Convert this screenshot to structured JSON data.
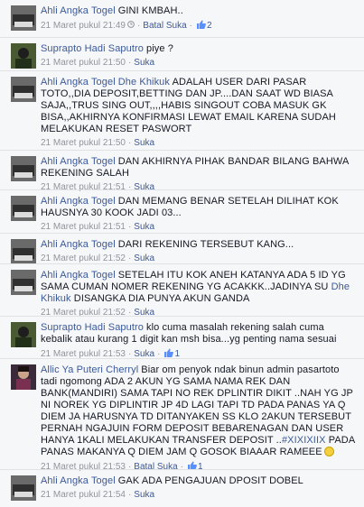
{
  "comments": [
    {
      "author": "Ahli Angka Togel",
      "text": "GINI KMBAH..",
      "timestamp": "21 Maret pukul 21:49",
      "action": "Batal Suka",
      "likes": "2"
    },
    {
      "author": "Suprapto Hadi Saputro",
      "text": "piye ?",
      "timestamp": "21 Maret pukul 21:50",
      "action": "Suka"
    },
    {
      "author": "Ahli Angka Togel",
      "mention": "Dhe Khikuk",
      "text": "ADALAH USER DARI PASAR TOTO,,DIA DEPOSIT,BETTING DAN JP....DAN SAAT WD BIASA SAJA,,TRUS SING OUT,,,,HABIS SINGOUT COBA MASUK GK BISA,,AKHIRNYA KONFIRMASI LEWAT EMAIL KARENA SUDAH MELAKUKAN RESET PASWORT",
      "timestamp": "21 Maret pukul 21:50",
      "action": "Suka"
    },
    {
      "author": "Ahli Angka Togel",
      "text": "DAN AKHIRNYA PIHAK BANDAR BILANG BAHWA REKENING SALAH",
      "timestamp": "21 Maret pukul 21:51",
      "action": "Suka"
    },
    {
      "author": "Ahli Angka Togel",
      "text": "DAN MEMANG BENAR SETELAH DILIHAT KOK HAUSNYA 30 KOOK JADI 03...",
      "timestamp": "21 Maret pukul 21:51",
      "action": "Suka"
    },
    {
      "author": "Ahli Angka Togel",
      "text": "DARI REKENING TERSEBUT KANG...",
      "timestamp": "21 Maret pukul 21:52",
      "action": "Suka"
    },
    {
      "author": "Ahli Angka Togel",
      "text": "SETELAH ITU KOK ANEH KATANYA ADA 5 ID YG SAMA CUMAN NOMER REKENING YG ACAKKK..JADINYA SU",
      "mention_inline": "Dhe Khikuk",
      "text_after": "DISANGKA DIA PUNYA AKUN GANDA",
      "timestamp": "21 Maret pukul 21:52",
      "action": "Suka"
    },
    {
      "author": "Suprapto Hadi Saputro",
      "text": "klo cuma masalah rekening salah cuma kebalik atau kurang 1 digit kan msh bisa...yg penting nama sesuai",
      "timestamp": "21 Maret pukul 21:53",
      "action": "Suka",
      "likes": "1"
    },
    {
      "author": "Allic Ya Puteri Cherryl",
      "text": "Biar om penyok ndak binun admin pasartoto tadi ngomong ADA 2 AKUN YG SAMA NAMA REK DAN BANK(MANDIRI) SAMA TAPI NO REK DPLINTIR DIKIT ..NAH YG JP NI NOREK YG DIPLINTIR JP 4D LAGI TAPI TD PADA PANAS YA Q DIEM JA HARUSNYA TD DITANYAKEN SS KLO 2AKUN TERSEBUT PERNAH NGAJUIN FORM DEPOSIT BEBARENAGAN DAN USER HANYA 1KALI MELAKUKAN TRANSFER DEPOSIT ..",
      "hashtag": "#XIXIXIIX",
      "text_after": "PADA PANAS MAKANYA Q DIEM JAM Q GOSOK BIAAAR RAMEEE",
      "timestamp": "21 Maret pukul 21:53",
      "action": "Batal Suka",
      "likes": "1"
    },
    {
      "author": "Ahli Angka Togel",
      "text": "GAK ADA PENGAJUAN DPOSIT DOBEL",
      "timestamp": "21 Maret pukul 21:54",
      "action": "Suka"
    }
  ],
  "icons": {
    "like": "thumbs-up-icon",
    "edited": "clock-icon",
    "emoji": "smile-emoji-icon"
  },
  "colors": {
    "link": "#3b5998",
    "meta": "#90949c",
    "background": "#f6f7f9"
  }
}
